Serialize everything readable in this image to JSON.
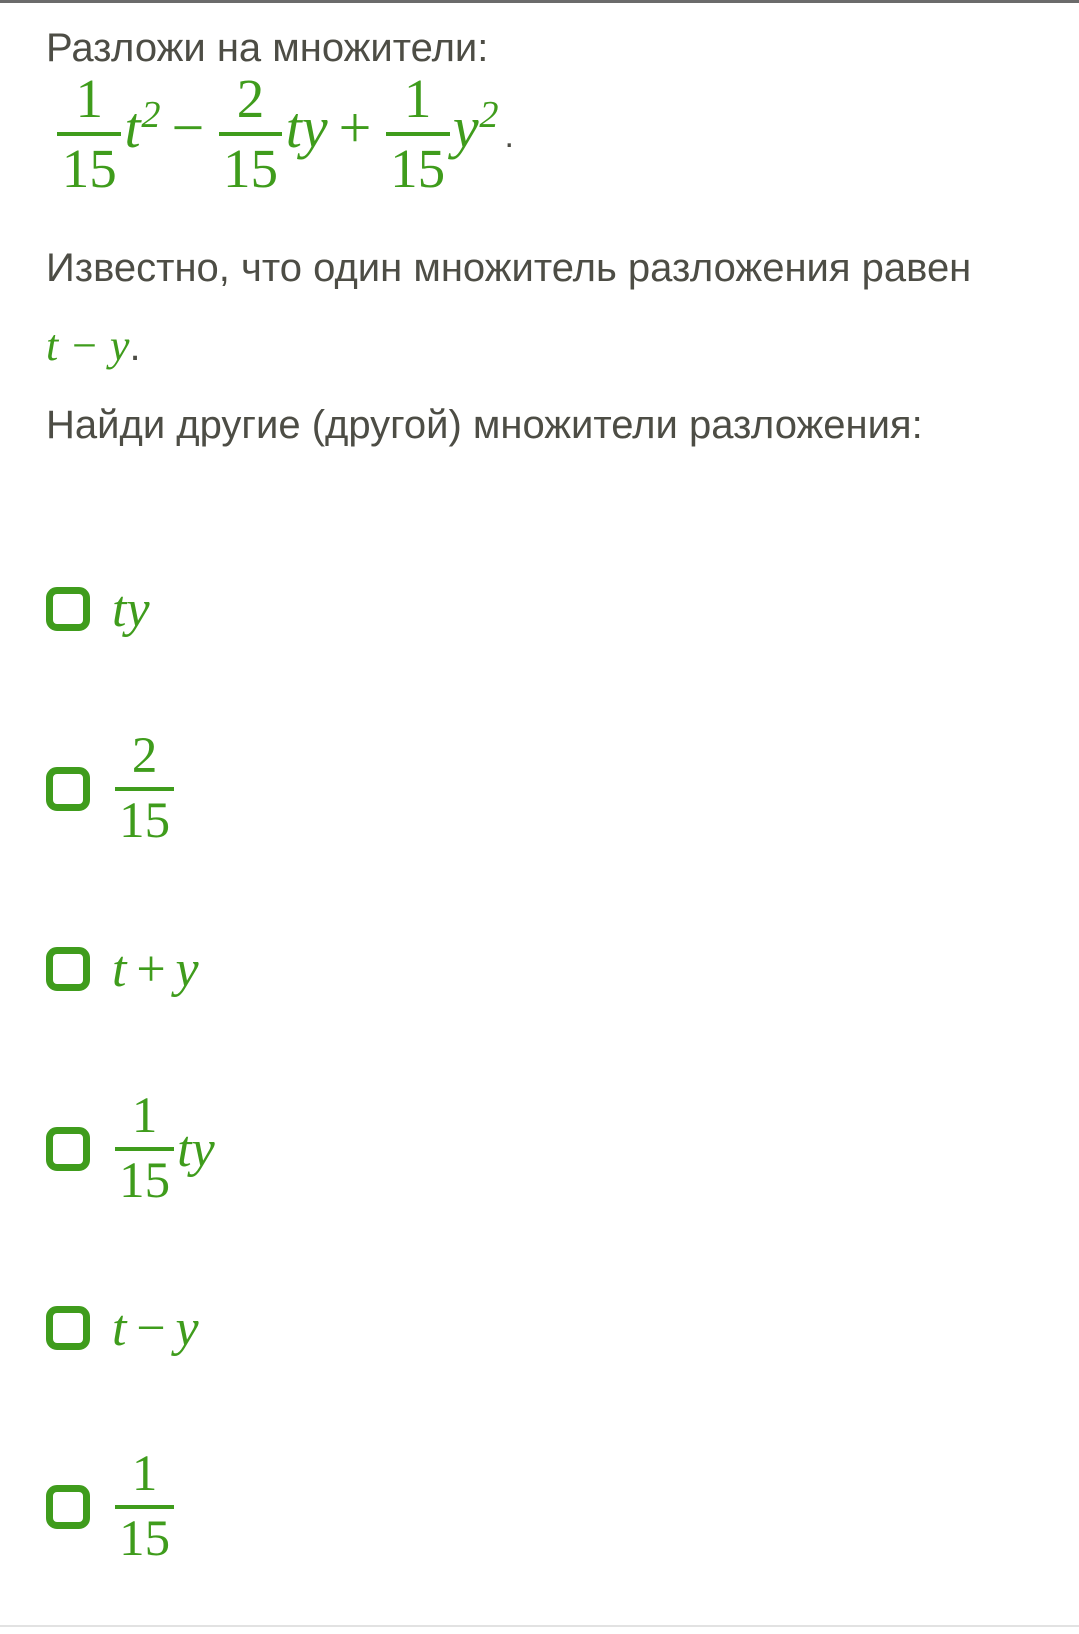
{
  "page": {
    "background_color": "#ffffff",
    "text_color": "#4d4d45",
    "accent_color": "#3f9c1c"
  },
  "question": {
    "prompt_line_1": "Разложи на множители:",
    "expression": {
      "term1": {
        "frac_num": "1",
        "frac_den": "15",
        "var": "t",
        "exp": "2"
      },
      "op1": "−",
      "term2": {
        "frac_num": "2",
        "frac_den": "15",
        "var": "ty"
      },
      "op2": "+",
      "term3": {
        "frac_num": "1",
        "frac_den": "15",
        "var": "y",
        "exp": "2"
      },
      "trailing_punctuation": "."
    },
    "known_text_before": "Известно, что один множитель разложения равен ",
    "known_factor": "t − y",
    "known_text_after": ".",
    "prompt_line_2": "Найди другие (другой) множители разложения:"
  },
  "options": [
    {
      "id": "opt-ty",
      "kind": "plain",
      "text": "ty",
      "checked": false
    },
    {
      "id": "opt-2-15",
      "kind": "frac",
      "num": "2",
      "den": "15",
      "suffix": "",
      "checked": false
    },
    {
      "id": "opt-t-plus-y",
      "kind": "binop",
      "left": "t",
      "op": "+",
      "right": "y",
      "checked": false
    },
    {
      "id": "opt-1-15-ty",
      "kind": "frac",
      "num": "1",
      "den": "15",
      "suffix": "ty",
      "checked": false
    },
    {
      "id": "opt-t-minus-y",
      "kind": "binop",
      "left": "t",
      "op": "−",
      "right": "y",
      "checked": false
    },
    {
      "id": "opt-1-15",
      "kind": "frac",
      "num": "1",
      "den": "15",
      "suffix": "",
      "checked": false
    }
  ]
}
